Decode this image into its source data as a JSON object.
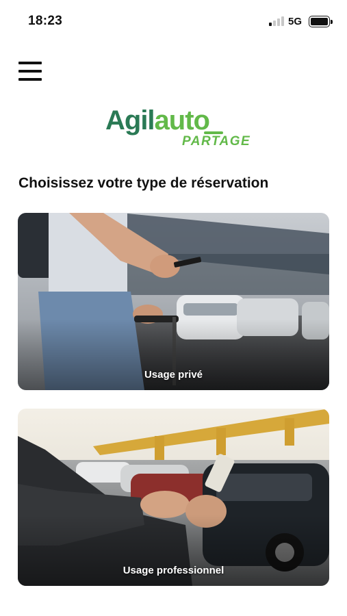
{
  "status_bar": {
    "time": "18:23",
    "network": "5G",
    "signal_icon": "cellular-signal-icon",
    "battery_icon": "battery-icon"
  },
  "header": {
    "menu_icon": "hamburger-menu-icon"
  },
  "logo": {
    "brand_part1": "Agil",
    "brand_part2": "auto",
    "tagline": "PARTAGE",
    "colors": {
      "dark_green": "#2a7a55",
      "light_green": "#62b949"
    }
  },
  "main": {
    "title": "Choisissez votre type de réservation",
    "cards": [
      {
        "label": "Usage privé"
      },
      {
        "label": "Usage professionnel"
      }
    ]
  }
}
